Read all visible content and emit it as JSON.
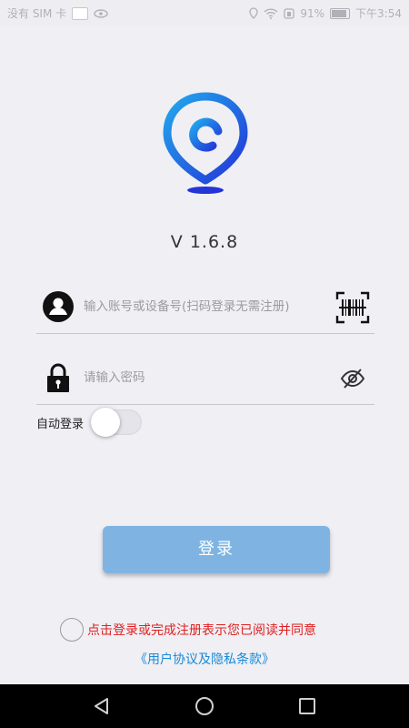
{
  "status_bar": {
    "carrier": "没有 SIM 卡",
    "battery": "91%",
    "time": "下午3:54"
  },
  "app": {
    "version": "V 1.6.8",
    "brand_color": "#1f5de0"
  },
  "account": {
    "placeholder": "输入账号或设备号(扫码登录无需注册)",
    "value": ""
  },
  "password": {
    "placeholder": "请输入密码",
    "value": ""
  },
  "auto_login": {
    "label": "自动登录",
    "enabled": false
  },
  "login_button": {
    "label": "登录",
    "color": "#7fb4e2"
  },
  "agreement": {
    "text": "点击登录或完成注册表示您已阅读并同意",
    "link": "《用户协议及隐私条款》",
    "checked": false
  },
  "icons": {
    "account": "user-icon",
    "scan": "barcode-scan-icon",
    "lock": "lock-icon",
    "visibility": "eye-hidden-icon"
  }
}
